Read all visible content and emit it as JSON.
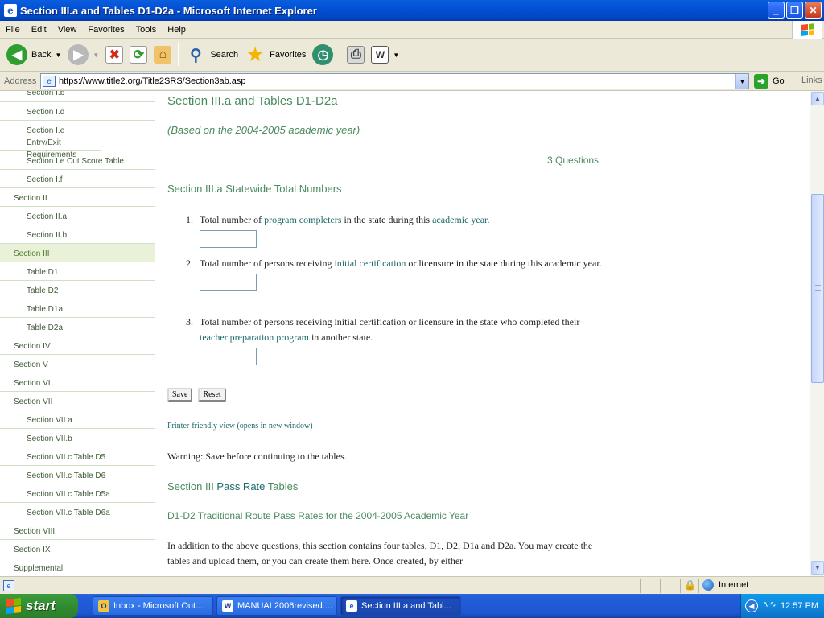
{
  "window": {
    "title": "Section III.a and Tables D1-D2a - Microsoft Internet Explorer",
    "app_icon": "ie-icon"
  },
  "menu": [
    "File",
    "Edit",
    "View",
    "Favorites",
    "Tools",
    "Help"
  ],
  "toolbar": {
    "back": "Back",
    "search": "Search",
    "favorites": "Favorites"
  },
  "address": {
    "label": "Address",
    "url": "https://www.title2.org/Title2SRS/Section3ab.asp",
    "go": "Go",
    "links": "Links"
  },
  "sidebar": {
    "items": [
      {
        "label": "Section I.b",
        "level": "sub",
        "active": false
      },
      {
        "label": "Section I.d",
        "level": "sub",
        "active": false
      },
      {
        "label": "Section I.e Entry/Exit Requirements",
        "level": "sub",
        "active": false
      },
      {
        "label": "Section I.e Cut Score Table",
        "level": "sub",
        "active": false
      },
      {
        "label": "Section I.f",
        "level": "sub",
        "active": false
      },
      {
        "label": "Section II",
        "level": "top",
        "active": false
      },
      {
        "label": "Section II.a",
        "level": "sub",
        "active": false
      },
      {
        "label": "Section II.b",
        "level": "sub",
        "active": false
      },
      {
        "label": "Section III",
        "level": "top",
        "active": true
      },
      {
        "label": "Table D1",
        "level": "sub",
        "active": false
      },
      {
        "label": "Table D2",
        "level": "sub",
        "active": false
      },
      {
        "label": "Table D1a",
        "level": "sub",
        "active": false
      },
      {
        "label": "Table D2a",
        "level": "sub",
        "active": false
      },
      {
        "label": "Section IV",
        "level": "top",
        "active": false
      },
      {
        "label": "Section V",
        "level": "top",
        "active": false
      },
      {
        "label": "Section VI",
        "level": "top",
        "active": false
      },
      {
        "label": "Section VII",
        "level": "top",
        "active": false
      },
      {
        "label": "Section VII.a",
        "level": "sub",
        "active": false
      },
      {
        "label": "Section VII.b",
        "level": "sub",
        "active": false
      },
      {
        "label": "Section VII.c Table D5",
        "level": "sub",
        "active": false
      },
      {
        "label": "Section VII.c Table D6",
        "level": "sub",
        "active": false
      },
      {
        "label": "Section VII.c Table D5a",
        "level": "sub",
        "active": false
      },
      {
        "label": "Section VII.c Table D6a",
        "level": "sub",
        "active": false
      },
      {
        "label": "Section VIII",
        "level": "top",
        "active": false
      },
      {
        "label": "Section IX",
        "level": "top",
        "active": false
      },
      {
        "label": "Supplemental",
        "level": "top",
        "active": false
      }
    ]
  },
  "main": {
    "title": "Section III.a and Tables D1-D2a",
    "subtitle": "(Based on the 2004-2005 academic year)",
    "question_count": "3 Questions",
    "section_heading": "Section III.a Statewide Total Numbers",
    "questions": [
      {
        "num": "1.",
        "pre": "Total number of ",
        "link1": "program completers",
        "mid": " in the state during this ",
        "link2": "academic year",
        "post": ".",
        "value": ""
      },
      {
        "num": "2.",
        "pre": "Total number of persons receiving ",
        "link1": "initial certification",
        "mid": " or licensure in the state during this academic year.",
        "value": ""
      },
      {
        "num": "3.",
        "pre": "Total number of persons receiving initial certification or licensure in the state who completed their ",
        "link1": "teacher preparation program",
        "mid": " in another state.",
        "value": ""
      }
    ],
    "save_label": "Save",
    "reset_label": "Reset",
    "printer_link": "Printer-friendly view (opens in new window)",
    "warning": "Warning: Save before continuing to the tables.",
    "pass_heading_pre": "Section III ",
    "pass_heading_link": "Pass Rate",
    "pass_heading_post": " Tables",
    "d1d2_heading": "D1-D2 Traditional Route Pass Rates for the 2004-2005 Academic Year",
    "paragraph": "In addition to the above questions, this section contains four tables, D1, D2, D1a and D2a. You may create the tables and upload them, or you can create them here. Once created, by either"
  },
  "status": {
    "zone": "Internet"
  },
  "taskbar": {
    "start": "start",
    "tasks": [
      {
        "label": "Inbox - Microsoft Out...",
        "icon": "outlook-icon",
        "active": false
      },
      {
        "label": "MANUAL2006revised....",
        "icon": "word-icon",
        "active": false
      },
      {
        "label": "Section III.a and Tabl...",
        "icon": "ie-icon",
        "active": true
      }
    ],
    "clock": "12:57 PM"
  },
  "colors": {
    "heading_green": "#4a8a5e",
    "link_teal": "#1a6a6a",
    "nav_border": "#cfe0c7",
    "nav_active": "#e9f1d9"
  }
}
